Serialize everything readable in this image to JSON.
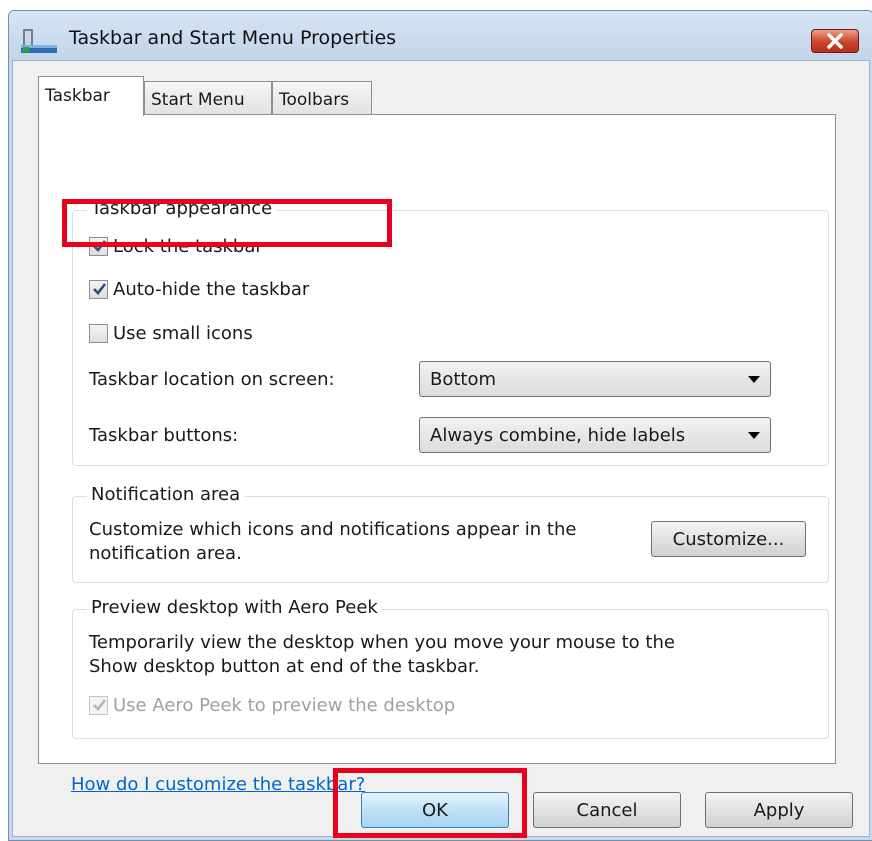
{
  "window": {
    "title": "Taskbar and Start Menu Properties"
  },
  "tabs": [
    {
      "label": "Taskbar",
      "active": true
    },
    {
      "label": "Start Menu",
      "active": false
    },
    {
      "label": "Toolbars",
      "active": false
    }
  ],
  "appearance": {
    "legend": "Taskbar appearance",
    "lock_label": "Lock the taskbar",
    "lock_checked": true,
    "autohide_label": "Auto-hide the taskbar",
    "autohide_checked": true,
    "small_icons_label": "Use small icons",
    "small_icons_checked": false,
    "location_label": "Taskbar location on screen:",
    "location_value": "Bottom",
    "buttons_label": "Taskbar buttons:",
    "buttons_value": "Always combine, hide labels"
  },
  "notification": {
    "legend": "Notification area",
    "text_line1": "Customize which icons and notifications appear in the",
    "text_line2": "notification area.",
    "customize_button": "Customize..."
  },
  "aero_peek": {
    "legend": "Preview desktop with Aero Peek",
    "text_line1": "Temporarily view the desktop when you move your mouse to the",
    "text_line2": "Show desktop button at end of the taskbar.",
    "checkbox_label": "Use Aero Peek to preview the desktop",
    "checkbox_checked": true,
    "checkbox_disabled": true
  },
  "help_link": "How do I customize the taskbar?",
  "buttons": {
    "ok": "OK",
    "cancel": "Cancel",
    "apply": "Apply"
  },
  "colors": {
    "highlight": "#e8001d",
    "link": "#0066cc"
  }
}
